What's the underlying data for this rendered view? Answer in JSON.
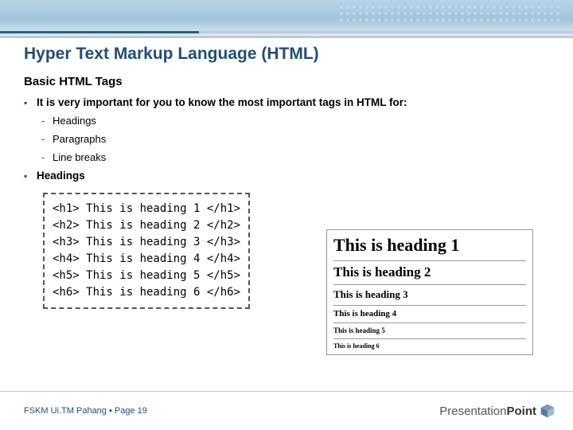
{
  "slide": {
    "title": "Hyper Text Markup Language (HTML)",
    "subtitle": "Basic HTML Tags",
    "bullet_intro": "It is very important for you to know the most important tags in HTML for:",
    "sub_items": [
      "Headings",
      "Paragraphs",
      "Line breaks"
    ],
    "bullet_headings": "Headings",
    "code": "<h1> This is heading 1 </h1>\n<h2> This is heading 2 </h2>\n<h3> This is heading 3 </h3>\n<h4> This is heading 4 </h4>\n<h5> This is heading 5 </h5>\n<h6> This is heading 6 </h6>",
    "preview": {
      "h1": "This is heading 1",
      "h2": "This is heading 2",
      "h3": "This is heading 3",
      "h4": "This is heading 4",
      "h5": "This is heading 5",
      "h6": "This is heading 6"
    },
    "footer": "FSKM Ui.TM Pahang  ▪  Page 19",
    "logo_text_light": "Presentation",
    "logo_text_bold": "Point"
  }
}
